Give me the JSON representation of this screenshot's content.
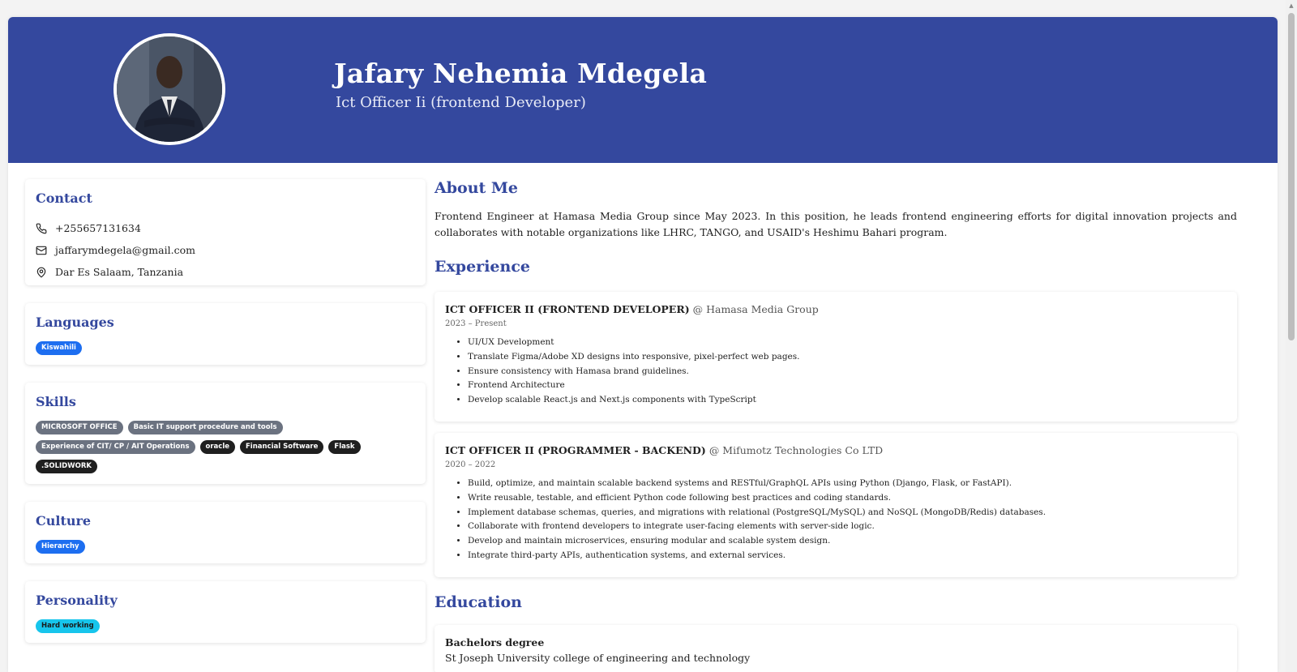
{
  "profile": {
    "name": "Jafary Nehemia Mdegela",
    "title": "Ict Officer Ii (frontend Developer)"
  },
  "contact": {
    "heading": "Contact",
    "phone": "+255657131634",
    "email": "jaffarymdegela@gmail.com",
    "location": "Dar Es Salaam, Tanzania",
    "icons": [
      "phone-icon",
      "mail-icon",
      "location-pin-icon"
    ]
  },
  "languages": {
    "heading": "Languages",
    "items": [
      "Kiswahili"
    ]
  },
  "skills": {
    "heading": "Skills",
    "items": [
      "MICROSOFT OFFICE",
      "Basic IT support procedure and tools",
      "Experience of CIT/ CP / AIT Operations",
      "oracle",
      "Financial Software",
      "Flask",
      ".SOLIDWORK"
    ]
  },
  "culture": {
    "heading": "Culture",
    "items": [
      "Hierarchy"
    ]
  },
  "personality": {
    "heading": "Personality",
    "items": [
      "Hard working"
    ]
  },
  "about": {
    "heading": "About Me",
    "text": "Frontend Engineer at Hamasa Media Group since May 2023. In this position, he leads frontend engineering efforts for digital innovation projects and collaborates with notable organizations like LHRC, TANGO, and USAID's Heshimu Bahari program."
  },
  "experience": {
    "heading": "Experience",
    "jobs": [
      {
        "role": "ICT OFFICER II (FRONTEND DEVELOPER)",
        "org": "@ Hamasa Media Group",
        "dates": "2023 – Present",
        "bullets": [
          "UI/UX Development",
          "Translate Figma/Adobe XD designs into responsive, pixel-perfect web pages.",
          "Ensure consistency with Hamasa brand guidelines.",
          "Frontend Architecture",
          "Develop scalable React.js and Next.js components with TypeScript"
        ]
      },
      {
        "role": "ICT OFFICER II (PROGRAMMER - BACKEND)",
        "org": "@ Mifumotz Technologies Co LTD",
        "dates": "2020 – 2022",
        "bullets": [
          "Build, optimize, and maintain scalable backend systems and RESTful/GraphQL APIs using Python (Django, Flask, or FastAPI).",
          "Write reusable, testable, and efficient Python code following best practices and coding standards.",
          "Implement database schemas, queries, and migrations with relational (PostgreSQL/MySQL) and NoSQL (MongoDB/Redis) databases.",
          "Collaborate with frontend developers to integrate user-facing elements with server-side logic.",
          "Develop and maintain microservices, ensuring modular and scalable system design.",
          "Integrate third-party APIs, authentication systems, and external services."
        ]
      }
    ]
  },
  "education": {
    "heading": "Education",
    "degree": "Bachelors degree",
    "school": "St Joseph University college of engineering and technology"
  },
  "colors": {
    "header": "#34489e",
    "accent": "#34489e",
    "tag_blue": "#1d6ef0",
    "tag_cyan": "#17c5ec",
    "tag_grey": "#6b7280",
    "tag_dark": "#1f1f1f"
  }
}
